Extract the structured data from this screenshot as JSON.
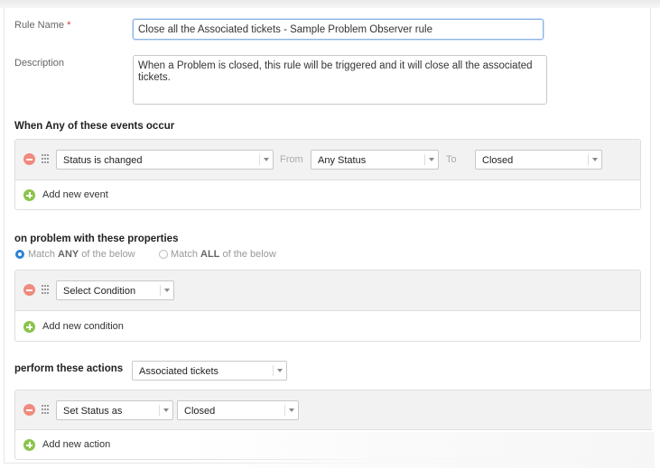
{
  "form": {
    "rule_name_label": "Rule Name",
    "required_mark": "*",
    "rule_name_value": "Close all the Associated tickets - Sample Problem Observer rule",
    "description_label": "Description",
    "description_value": "When a Problem is closed, this rule will be triggered and it will close all the associated tickets."
  },
  "events": {
    "title": "When Any of these events occur",
    "rows": [
      {
        "field": "Status is changed",
        "from_label": "From",
        "from_value": "Any Status",
        "to_label": "To",
        "to_value": "Closed"
      }
    ],
    "add_label": "Add new event"
  },
  "conditions": {
    "title": "on problem with these properties",
    "match_any_prefix": "Match ",
    "match_any_bold": "ANY",
    "match_any_suffix": " of the below",
    "match_all_prefix": "Match ",
    "match_all_bold": "ALL",
    "match_all_suffix": " of the below",
    "selected": "any",
    "rows": [
      {
        "field": "Select Condition"
      }
    ],
    "add_label": "Add new condition"
  },
  "actions": {
    "title": "perform these actions",
    "target": "Associated tickets",
    "rows": [
      {
        "field": "Set Status as",
        "value": "Closed"
      }
    ],
    "add_label": "Add new action"
  },
  "colors": {
    "remove": "#f08a7e",
    "add": "#8bc34a",
    "radio_selected": "#2d82d6",
    "required": "#d9342b"
  }
}
